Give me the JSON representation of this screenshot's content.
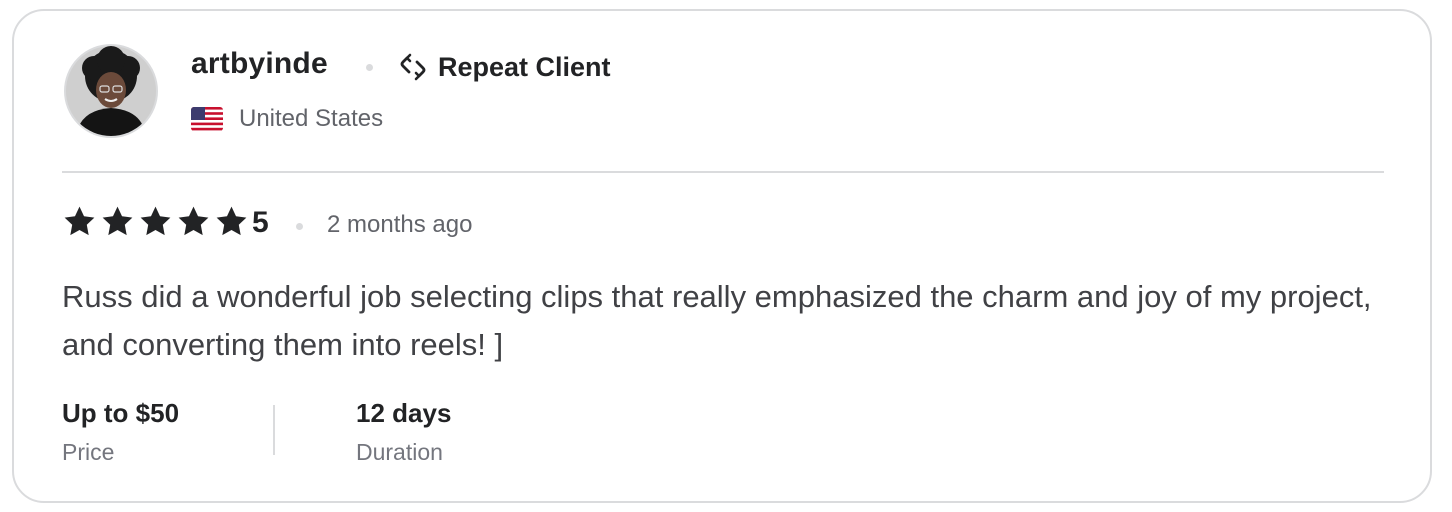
{
  "reviewer": {
    "username": "artbyinde",
    "badge_label": "Repeat Client",
    "badge_icon": "repeat-icon",
    "country": "United States",
    "country_flag": "us-flag-icon"
  },
  "review": {
    "stars": 5,
    "rating_value": "5",
    "time_ago": "2 months ago",
    "text": "Russ did a wonderful job selecting clips that really emphasized the charm and joy of my project, and converting them into reels! ]"
  },
  "meta": {
    "price_value": "Up to $50",
    "price_label": "Price",
    "duration_value": "12 days",
    "duration_label": "Duration"
  },
  "colors": {
    "text_primary": "#222325",
    "text_secondary": "#62646a",
    "border": "#dadbdd",
    "star": "#222325"
  }
}
